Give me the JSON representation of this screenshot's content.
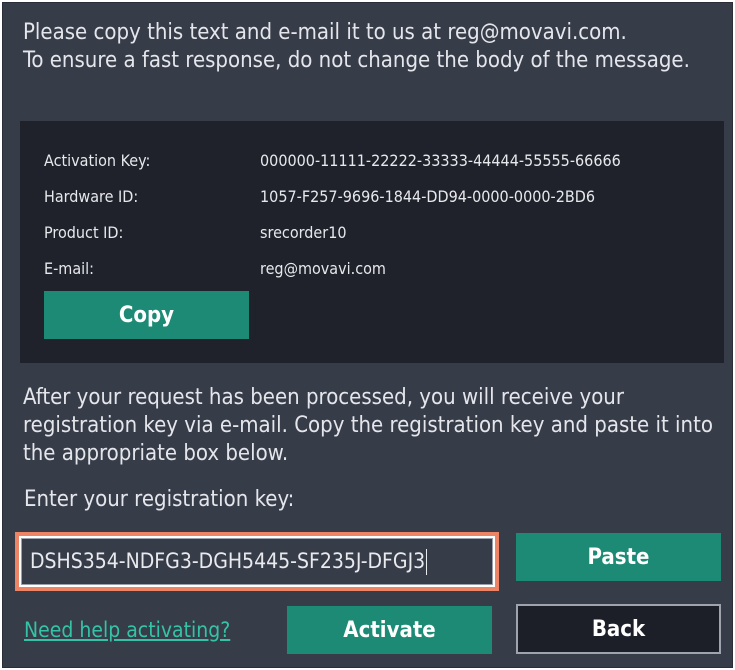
{
  "intro_text": "Please copy this text and e-mail it to us at reg@movavi.com.\nTo ensure a fast response, do not change the body of the message.",
  "info": {
    "rows": [
      {
        "label": "Activation Key:",
        "value": "000000-11111-22222-33333-44444-55555-66666"
      },
      {
        "label": "Hardware ID:",
        "value": "1057-F257-9696-1844-DD94-0000-0000-2BD6"
      },
      {
        "label": "Product ID:",
        "value": "srecorder10"
      },
      {
        "label": "E-mail:",
        "value": "reg@movavi.com"
      }
    ],
    "copy_label": "Copy"
  },
  "instructions": "After your request has been processed, you will receive your registration key via e-mail. Copy the registration key and paste it into the appropriate box below.",
  "registration": {
    "label": "Enter your registration key:",
    "value": "DSHS354-NDFG3-DGH5445-SF235J-DFGJ3",
    "paste_label": "Paste"
  },
  "footer": {
    "help_link": "Need help activating?",
    "activate_label": "Activate",
    "back_label": "Back"
  },
  "colors": {
    "background": "#373c49",
    "panel": "#1f222b",
    "accent_button": "#1d8a75",
    "link": "#35c3a7",
    "highlight_border": "#ee8466"
  }
}
